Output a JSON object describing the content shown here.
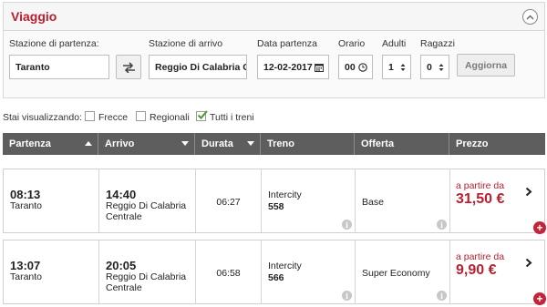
{
  "panel": {
    "title": "Viaggio"
  },
  "form": {
    "departure_label": "Stazione di partenza:",
    "departure_value": "Taranto",
    "arrival_label": "Stazione di arrivo",
    "arrival_value": "Reggio Di Calabria C",
    "date_label": "Data partenza",
    "date_value": "12-02-2017",
    "time_label": "Orario",
    "time_value": "00",
    "adults_label": "Adulti",
    "adults_value": "1",
    "kids_label": "Ragazzi",
    "kids_value": "0",
    "update_label": "Aggiorna"
  },
  "filters": {
    "label": "Stai visualizzando:",
    "items": [
      {
        "label": "Frecce",
        "checked": false
      },
      {
        "label": "Regionali",
        "checked": false
      },
      {
        "label": "Tutti i treni",
        "checked": true
      }
    ]
  },
  "table": {
    "headers": [
      "Partenza",
      "Arrivo",
      "Durata",
      "Treno",
      "Offerta",
      "Prezzo"
    ],
    "rows": [
      {
        "dep_time": "08:13",
        "dep_station": "Taranto",
        "arr_time": "14:40",
        "arr_station": "Reggio Di Calabria Centrale",
        "duration": "06:27",
        "train_type": "Intercity",
        "train_number": "558",
        "offer": "Base",
        "from_label": "a partire da",
        "price": "31,50 €"
      },
      {
        "dep_time": "13:07",
        "dep_station": "Taranto",
        "arr_time": "20:05",
        "arr_station": "Reggio Di Calabria Centrale",
        "duration": "06:58",
        "train_type": "Intercity",
        "train_number": "566",
        "offer": "Super Economy",
        "from_label": "a partire da",
        "price": "9,90 €"
      }
    ]
  },
  "colors": {
    "accent": "#b8202f",
    "header_bg": "#5e5e5e",
    "plus": "#c4243a"
  },
  "icons": [
    "chevron-up-icon",
    "swap-icon",
    "calendar-icon",
    "clock-icon",
    "stepper-icon",
    "sort-icon",
    "info-icon",
    "chevron-right-icon",
    "plus-icon",
    "checkmark-icon"
  ]
}
